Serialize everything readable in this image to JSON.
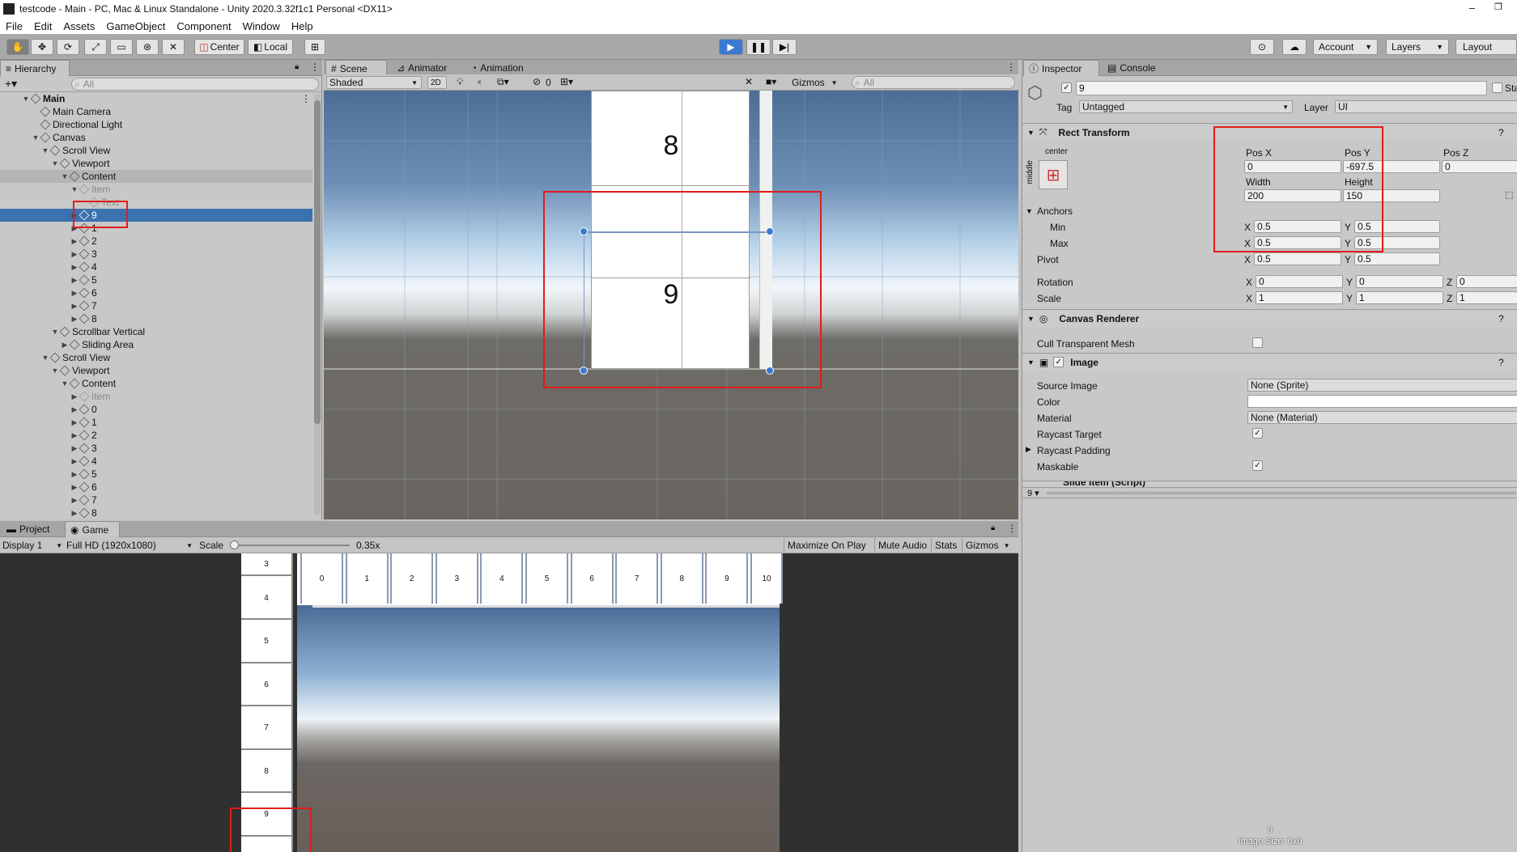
{
  "window": {
    "title": "testcode - Main - PC, Mac & Linux Standalone - Unity 2020.3.32f1c1 Personal <DX11>"
  },
  "menu": [
    "File",
    "Edit",
    "Assets",
    "GameObject",
    "Component",
    "Window",
    "Help"
  ],
  "toolbar": {
    "center_label": "Center",
    "local_label": "Local",
    "account_label": "Account",
    "layers_label": "Layers",
    "layout_label": "Layout"
  },
  "hierarchy": {
    "tab": "Hierarchy",
    "search_placeholder": "All",
    "rows": [
      {
        "label": "Main",
        "depth": 0,
        "tri": "▼",
        "bold": true,
        "scene": true
      },
      {
        "label": "Main Camera",
        "depth": 1,
        "tri": ""
      },
      {
        "label": "Directional Light",
        "depth": 1,
        "tri": ""
      },
      {
        "label": "Canvas",
        "depth": 1,
        "tri": "▼"
      },
      {
        "label": "Scroll View",
        "depth": 2,
        "tri": "▼"
      },
      {
        "label": "Viewport",
        "depth": 3,
        "tri": "▼"
      },
      {
        "label": "Content",
        "depth": 4,
        "tri": "▼",
        "hl": true
      },
      {
        "label": "Item",
        "depth": 5,
        "tri": "▼",
        "dim": true
      },
      {
        "label": "Text",
        "depth": 6,
        "tri": "",
        "dim": true
      },
      {
        "label": "9",
        "depth": 5,
        "tri": "▶",
        "selected": true
      },
      {
        "label": "1",
        "depth": 5,
        "tri": "▶"
      },
      {
        "label": "2",
        "depth": 5,
        "tri": "▶"
      },
      {
        "label": "3",
        "depth": 5,
        "tri": "▶"
      },
      {
        "label": "4",
        "depth": 5,
        "tri": "▶"
      },
      {
        "label": "5",
        "depth": 5,
        "tri": "▶"
      },
      {
        "label": "6",
        "depth": 5,
        "tri": "▶"
      },
      {
        "label": "7",
        "depth": 5,
        "tri": "▶"
      },
      {
        "label": "8",
        "depth": 5,
        "tri": "▶"
      },
      {
        "label": "Scrollbar Vertical",
        "depth": 3,
        "tri": "▼"
      },
      {
        "label": "Sliding Area",
        "depth": 4,
        "tri": "▶"
      },
      {
        "label": "Scroll View",
        "depth": 2,
        "tri": "▼"
      },
      {
        "label": "Viewport",
        "depth": 3,
        "tri": "▼"
      },
      {
        "label": "Content",
        "depth": 4,
        "tri": "▼"
      },
      {
        "label": "Item",
        "depth": 5,
        "tri": "▶",
        "dim": true
      },
      {
        "label": "0",
        "depth": 5,
        "tri": "▶"
      },
      {
        "label": "1",
        "depth": 5,
        "tri": "▶"
      },
      {
        "label": "2",
        "depth": 5,
        "tri": "▶"
      },
      {
        "label": "3",
        "depth": 5,
        "tri": "▶"
      },
      {
        "label": "4",
        "depth": 5,
        "tri": "▶"
      },
      {
        "label": "5",
        "depth": 5,
        "tri": "▶"
      },
      {
        "label": "6",
        "depth": 5,
        "tri": "▶"
      },
      {
        "label": "7",
        "depth": 5,
        "tri": "▶"
      },
      {
        "label": "8",
        "depth": 5,
        "tri": "▶"
      }
    ]
  },
  "scene": {
    "tabs": [
      "Scene",
      "Animator",
      "Animation"
    ],
    "shading": "Shaded",
    "mode_2d": "2D",
    "hidden_count": "0",
    "gizmos": "Gizmos",
    "search_placeholder": "All",
    "item_top": "8",
    "item_bottom": "9"
  },
  "game": {
    "tabs": [
      "Project",
      "Game"
    ],
    "display": "Display 1",
    "resolution": "Full HD (1920x1080)",
    "scale_label": "Scale",
    "scale_value": "0.35x",
    "maximize": "Maximize On Play",
    "mute": "Mute Audio",
    "stats": "Stats",
    "gizmos": "Gizmos",
    "h_items": [
      "0",
      "1",
      "2",
      "3",
      "4",
      "5",
      "6",
      "7",
      "8",
      "9",
      "10"
    ],
    "v_items": [
      "3",
      "4",
      "5",
      "6",
      "7",
      "8",
      "9"
    ]
  },
  "inspector": {
    "tabs": [
      "Inspector",
      "Console"
    ],
    "object_name": "9",
    "static_label": "Sta",
    "tag_label": "Tag",
    "tag_value": "Untagged",
    "layer_label": "Layer",
    "layer_value": "UI",
    "rect": {
      "title": "Rect Transform",
      "anchor_h": "center",
      "anchor_v": "middle",
      "posx_label": "Pos X",
      "posy_label": "Pos Y",
      "posz_label": "Pos Z",
      "posx": "0",
      "posy": "-697.5",
      "posz": "0",
      "width_label": "Width",
      "height_label": "Height",
      "width": "200",
      "height": "150",
      "anchors_label": "Anchors",
      "min_label": "Min",
      "max_label": "Max",
      "pivot_label": "Pivot",
      "min_x": "0.5",
      "min_y": "0.5",
      "max_x": "0.5",
      "max_y": "0.5",
      "pivot_x": "0.5",
      "pivot_y": "0.5",
      "rotation_label": "Rotation",
      "rot_x": "0",
      "rot_y": "0",
      "rot_z": "0",
      "scale_label": "Scale",
      "scale_x": "1",
      "scale_y": "1",
      "scale_z": "1"
    },
    "canvas_renderer": {
      "title": "Canvas Renderer",
      "cull_label": "Cull Transparent Mesh"
    },
    "image": {
      "title": "Image",
      "source_label": "Source Image",
      "source_value": "None (Sprite)",
      "color_label": "Color",
      "material_label": "Material",
      "material_value": "None (Material)",
      "raycast_target": "Raycast Target",
      "raycast_padding": "Raycast Padding",
      "maskable": "Maskable"
    },
    "slide_item": {
      "title": "Slide Item (Script)"
    },
    "preview_value": "9",
    "preview_name": "9",
    "image_size": "Image Size: 0x0"
  },
  "colors": {
    "selection": "#3a72b0",
    "play_blue": "#3c7ad1",
    "red": "#e21b1b"
  }
}
